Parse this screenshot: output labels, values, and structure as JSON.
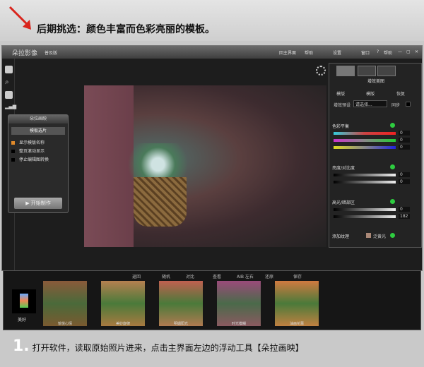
{
  "banner": {
    "headline": "后期挑选：颜色丰富而色彩亮丽的模板。"
  },
  "window": {
    "app_name": "朵拉影像",
    "edition": "普及版",
    "title_buttons": [
      "回主界面",
      "帮助",
      "设置",
      "窗口",
      "?",
      "帮助"
    ]
  },
  "float_panel": {
    "title": "朵拉画映",
    "tab": "模板选片",
    "options": [
      "显示模版名称",
      "整页滚动显示",
      "停止编辑图转换"
    ],
    "start_button": "开始制作"
  },
  "right_panel": {
    "title": "增效美图",
    "actions": [
      "模版",
      "模版",
      "恢复"
    ],
    "preset_label": "增效预设",
    "preset_value": "请选择...",
    "sync_label": "同步",
    "sections": [
      {
        "name": "色彩平衡",
        "values": [
          "0",
          "0",
          "0"
        ]
      },
      {
        "name": "亮度/对比度",
        "values": [
          "0",
          "0"
        ]
      },
      {
        "name": "高光/暗部区",
        "values": [
          "0",
          "182"
        ]
      },
      {
        "name": "添加纹理",
        "extra": "泛黄光"
      }
    ]
  },
  "filmstrip": {
    "toolbar": [
      "返回",
      "随机",
      "对比",
      "查看",
      "AIB 左右",
      "还原",
      "保存"
    ],
    "category": "美好",
    "thumbnails": [
      "愉悦心情",
      "美妙旋律",
      "明媚阳光",
      "时光模糊",
      "油画花蕾"
    ]
  },
  "caption": {
    "number": "1.",
    "text": "打开软件，读取原始照片进来，点击主界面左边的浮动工具【朵拉画映】"
  },
  "colors": {
    "accent": "#2ecc40",
    "arrow": "#d9241c"
  }
}
